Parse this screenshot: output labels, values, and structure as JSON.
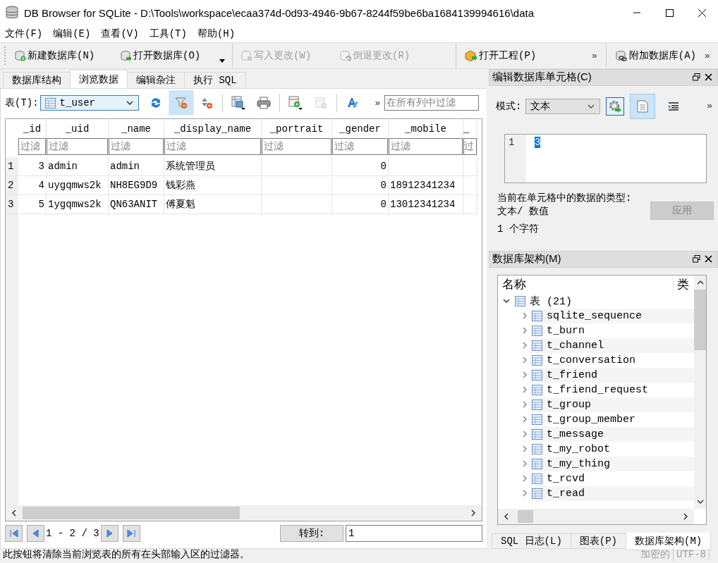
{
  "window": {
    "title": "DB Browser for SQLite - D:\\Tools\\workspace\\ecaa374d-0d93-4946-9b67-8244f59be6ba1684139994616\\data"
  },
  "menu": [
    "文件(F)",
    "编辑(E)",
    "查看(V)",
    "工具(T)",
    "帮助(H)"
  ],
  "toolbar": [
    {
      "kind": "new",
      "label": "新建数据库(N)",
      "disabled": false
    },
    {
      "kind": "open",
      "label": "打开数据库(O)",
      "disabled": false
    },
    {
      "kind": "write",
      "label": "写入更改(W)",
      "disabled": true
    },
    {
      "kind": "revert",
      "label": "倒退更改(R)",
      "disabled": true
    },
    {
      "kind": "project",
      "label": "打开工程(P)",
      "disabled": false
    },
    {
      "kind": "attach",
      "label": "附加数据库(A)",
      "disabled": false
    }
  ],
  "toolbar_overflow": [
    "»",
    "»"
  ],
  "tabs": [
    {
      "label": "数据库结构",
      "selected": false
    },
    {
      "label": "浏览数据",
      "selected": true
    },
    {
      "label": "编辑杂注",
      "selected": false
    },
    {
      "label": "执行 SQL",
      "selected": false
    }
  ],
  "browse": {
    "table_label": "表(T):",
    "table": "t_user",
    "tools": [
      {
        "kind": "refresh",
        "highlighted": false,
        "disabled": false
      },
      {
        "kind": "clear-filter",
        "highlighted": true,
        "disabled": false
      },
      {
        "kind": "clear-sort",
        "highlighted": false,
        "disabled": false
      },
      {
        "kind": "save",
        "highlighted": false,
        "disabled": false
      },
      {
        "kind": "print",
        "highlighted": false,
        "disabled": false
      },
      {
        "kind": "insert",
        "highlighted": false,
        "disabled": false
      },
      {
        "kind": "delete",
        "highlighted": false,
        "disabled": true
      },
      {
        "kind": "font",
        "highlighted": false,
        "disabled": false
      }
    ],
    "overflow": "»",
    "filter_placeholder": "在所有列中过滤",
    "columns": [
      {
        "name": "_id",
        "placeholder": "过滤",
        "kind": "number"
      },
      {
        "name": "_uid",
        "placeholder": "过滤",
        "kind": "text"
      },
      {
        "name": "_name",
        "placeholder": "过滤",
        "kind": "text"
      },
      {
        "name": "_display_name",
        "placeholder": "过滤",
        "kind": "text"
      },
      {
        "name": "_portrait",
        "placeholder": "过滤",
        "kind": "text"
      },
      {
        "name": "_gender",
        "placeholder": "过滤",
        "kind": "number"
      },
      {
        "name": "_mobile",
        "placeholder": "过滤",
        "kind": "text"
      },
      {
        "name": "_",
        "placeholder": "过",
        "kind": "text"
      }
    ],
    "rows": [
      {
        "number": "1",
        "cells": [
          "3",
          "admin",
          "admin",
          "系统管理员",
          null,
          "0",
          null,
          null
        ]
      },
      {
        "number": "2",
        "cells": [
          "4",
          "uygqmws2k",
          "NH8EG9D9",
          "钱彩燕",
          null,
          "0",
          "18912341234",
          null
        ]
      },
      {
        "number": "3",
        "cells": [
          "5",
          "1ygqmws2k",
          "QN63ANIT",
          "傅夏魁",
          null,
          "0",
          "13012341234",
          null
        ]
      }
    ],
    "pagination": "1 - 2 / 3",
    "goto_button": "转到:",
    "goto_value": "1"
  },
  "edit_cell": {
    "title": "编辑数据库单元格(C)",
    "mode_label": "模式:",
    "mode": "文本",
    "overflow": "»",
    "tools": [
      {
        "kind": "import-export",
        "selected": false
      },
      {
        "kind": "text",
        "selected": true
      },
      {
        "kind": "wrap",
        "selected": false
      }
    ],
    "line_number": "1",
    "value": "3",
    "type_label": "当前在单元格中的数据的类型:",
    "type_value": "文本/ 数值",
    "size": "1 个字符",
    "apply_button": "应用",
    "apply_disabled": true
  },
  "schema": {
    "title": "数据库架构(M)",
    "columns": [
      "名称",
      "类"
    ],
    "tree": [
      {
        "label": "表 (21)",
        "expanded": true,
        "children": [
          {
            "label": "sqlite_sequence",
            "expanded": false
          },
          {
            "label": "t_burn",
            "expanded": false
          },
          {
            "label": "t_channel",
            "expanded": false
          },
          {
            "label": "t_conversation",
            "expanded": false
          },
          {
            "label": "t_friend",
            "expanded": false
          },
          {
            "label": "t_friend_request",
            "expanded": false
          },
          {
            "label": "t_group",
            "expanded": false
          },
          {
            "label": "t_group_member",
            "expanded": false
          },
          {
            "label": "t_message",
            "expanded": false
          },
          {
            "label": "t_my_robot",
            "expanded": false
          },
          {
            "label": "t_my_thing",
            "expanded": false
          },
          {
            "label": "t_rcvd",
            "expanded": false
          },
          {
            "label": "t_read",
            "expanded": false
          }
        ]
      }
    ]
  },
  "dock_tabs": [
    {
      "label": "SQL 日志(L)",
      "selected": false
    },
    {
      "label": "图表(P)",
      "selected": false
    },
    {
      "label": "数据库架构(M)",
      "selected": true
    }
  ],
  "status": {
    "message": "此按钮将清除当前浏览表的所有在头部输入区的过滤器。",
    "encryption": "加密的",
    "encoding": "UTF-8"
  }
}
